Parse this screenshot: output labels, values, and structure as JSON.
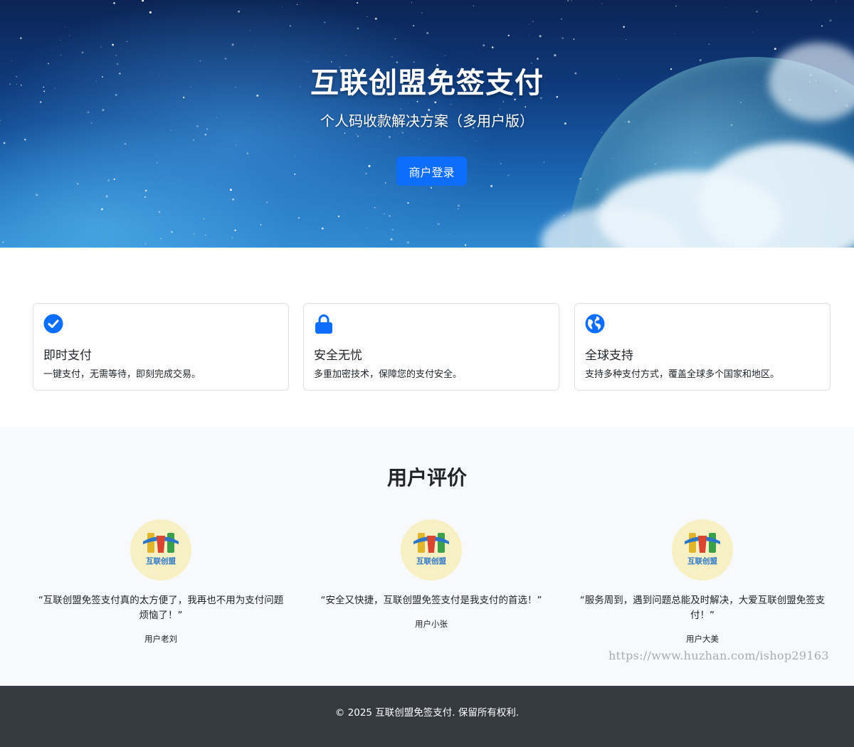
{
  "hero": {
    "title": "互联创盟免签支付",
    "subtitle": "个人码收款解决方案（多用户版）",
    "login_label": "商户登录"
  },
  "features": [
    {
      "icon": "check-circle-icon",
      "title": "即时支付",
      "text": "一键支付，无需等待，即刻完成交易。"
    },
    {
      "icon": "lock-icon",
      "title": "安全无忧",
      "text": "多重加密技术，保障您的支付安全。"
    },
    {
      "icon": "globe-icon",
      "title": "全球支持",
      "text": "支持多种支付方式，覆盖全球多个国家和地区。"
    }
  ],
  "reviews": {
    "heading": "用户评价",
    "logo_text": "互联创盟",
    "items": [
      {
        "quote": "“互联创盟免签支付真的太方便了，我再也不用为支付问题烦恼了！”",
        "author": "用户老刘"
      },
      {
        "quote": "“安全又快捷，互联创盟免签支付是我支付的首选！”",
        "author": "用户小张"
      },
      {
        "quote": "“服务周到，遇到问题总能及时解决，大爱互联创盟免签支付！”",
        "author": "用户大美"
      }
    ]
  },
  "watermark": "https://www.huzhan.com/ishop29163",
  "footer": {
    "copyright": "© 2025 互联创盟免签支付. 保留所有权利."
  },
  "colors": {
    "primary": "#0d6efd",
    "footer_bg": "#343a40",
    "section_bg": "#f8f9fa"
  }
}
